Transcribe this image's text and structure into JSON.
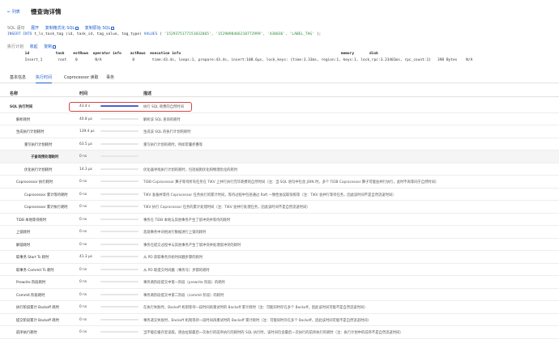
{
  "header": {
    "back_label": "列表",
    "title": "慢查询详情"
  },
  "sql": {
    "label": "SQL 语句",
    "expand": "展开",
    "copy_formatted": "复制格式化 SQL",
    "copy_original": "复制原始 SQL",
    "text_keyword1": "INSERT INTO",
    "text_body1": " t_ls_task_tag (id, task_id, tag_value, tag_type) ",
    "text_keyword2": "VALUES",
    "text_body2": " ( ",
    "text_values": "'1529375177151832065', '1529098466210772999', '438036', 'LABEL_TAG'",
    "text_end": " );"
  },
  "plan": {
    "label": "执行计划",
    "expand": "收起",
    "copy": "复制",
    "header": "        id            task    estRows  operator info    actRows  execution info                                                                         memory       disk",
    "row": "        Insert_1       root    0        N/A              0        time:43.4s, loops:1, prepare:43.4s, insert:108.6µs, lock_keys: {time:3.33ms, region:1, keys:1, lock_rpc:3.23401ms, rpc_count:1}   398 Bytes    N/A"
  },
  "tabs": [
    {
      "label": "基本信息",
      "active": false
    },
    {
      "label": "执行时间",
      "active": true
    },
    {
      "label": "Coprocessor 读取",
      "active": false
    },
    {
      "label": "事务",
      "active": false
    }
  ],
  "table": {
    "col_name": "名称",
    "col_time": "时间",
    "col_desc": "描述",
    "rows": [
      {
        "name": "SQL 执行时间",
        "time": "43.4 s",
        "fill": 1.0,
        "desc": "执行 SQL 耗费的自然时间",
        "indent": 0,
        "bold": true
      },
      {
        "name": "解析耗时",
        "time": "40.8 µs",
        "fill": 0.0,
        "desc": "解析该 SQL 查询的耗时",
        "indent": 1
      },
      {
        "name": "生成执行计划耗时",
        "time": "139.4 µs",
        "fill": 0.0,
        "desc": "生成该 SQL 的执行计划的耗时",
        "indent": 1
      },
      {
        "name": "重写执行计划耗时",
        "time": "63.5 µs",
        "fill": 0.0,
        "desc": "重写执行计划的耗时，例如常量折叠等",
        "indent": 2
      },
      {
        "name": "子查询预处理耗时",
        "time": "0 ns",
        "fill": 0.0,
        "desc": "",
        "indent": 3,
        "bold": true
      },
      {
        "name": "优化执行计划耗时",
        "time": "14.3 µs",
        "fill": 0.0,
        "desc": "优化器寻找执行计划的耗时，包括规则优化和物理优化的耗时",
        "indent": 2
      },
      {
        "name": "Coprocessor 执行耗时",
        "time": "0 ns",
        "fill": 0.0,
        "desc": "TiDB Coprocessor 算子等待所有任务在 TiKV 上并行执行完毕耗费的自然时间（注：当 SQL 语句中包含 JOIN 时，多个 TiDB Coprocessor 算子可能会并行执行，此时不再等同于自然时间）",
        "indent": 1
      },
      {
        "name": "Coprocessor 累计等待耗时",
        "time": "0 ns",
        "fill": 0.0,
        "desc": "TiKV 准备并等待 Coprocessor 任务执行的累计时间，等待过程中包括通过 Raft 一致性协议取快照等（注：TiKV 会并行等待任务，因此该时间不是自然流逝时间）",
        "indent": 2
      },
      {
        "name": "Coprocessor 累计执行耗时",
        "time": "0 ns",
        "fill": 0.0,
        "desc": "TiKV 执行 Coprocessor 任务的累计处理时间（注：TiKV 会并行处理任务，因此该时间不是自然流逝时间）",
        "indent": 2
      },
      {
        "name": "TiDB 本地等待耗时",
        "time": "0 ns",
        "fill": 0.0,
        "desc": "事务在 TiDB 本地与其他事务产生了锁冲突并等待的耗时",
        "indent": 1
      },
      {
        "name": "上锁耗时",
        "time": "0 ns",
        "fill": 0.0,
        "desc": "悲观事务中对相关行数据进行上锁的耗时",
        "indent": 1
      },
      {
        "name": "解锁耗时",
        "time": "0 ns",
        "fill": 0.0,
        "desc": "事务在提交过程中与其他事务产生了锁冲突并处理锁冲突的耗时",
        "indent": 1
      },
      {
        "name": "取事务 Start Ts 耗时",
        "time": "41.3 µs",
        "fill": 0.0,
        "desc": "从 PD 获取事务开始时间戳步骤的耗时",
        "indent": 1
      },
      {
        "name": "取事务 Commit Ts 耗时",
        "time": "0 ns",
        "fill": 0.0,
        "desc": "从 PD 取提交时间戳（事务号）步骤的耗时",
        "indent": 1
      },
      {
        "name": "Prewrite 阶段耗时",
        "time": "0 ns",
        "fill": 0.0,
        "desc": "事务两阶段提交中第一阶段（prewrite 阶段）的耗时",
        "indent": 1
      },
      {
        "name": "Commit 阶段耗时",
        "time": "0 ns",
        "fill": 0.0,
        "desc": "事务两阶段提交中第二阶段（commit 阶段）的耗时",
        "indent": 1
      },
      {
        "name": "执行阶段累计 Backoff 耗时",
        "time": "0 ns",
        "fill": 0.0,
        "desc": "在执行失败时，Backoff 机制等待一段时间再重试时的 Backoff 累计耗时（注：可能同时存在多个 Backoff，因此该时间可能不是自然流逝时间）",
        "indent": 1
      },
      {
        "name": "提交阶段累计 Backoff 耗时",
        "time": "0 ns",
        "fill": 0.0,
        "desc": "事务递交失败时，Backoff 机制等待一段时间再重试时的 Backoff 累计耗时（注：可能同时存在多个 Backoff，因此该时间可能不是自然流逝时间）",
        "indent": 1
      },
      {
        "name": "前序执行耗时",
        "time": "0 ns",
        "fill": 0.0,
        "desc": "当不能在缓存里读取，则会拉取最后一次执行的前序执行的耗时的 SQL 执行时，该时间包含最后一次执行的前序执行的耗时（注：执行计划中的前序不是自然流逝时间）",
        "indent": 1
      }
    ]
  },
  "colors": {
    "accent": "#1f5fd1",
    "bar": "#4a62d8",
    "highlight": "#d64545"
  }
}
